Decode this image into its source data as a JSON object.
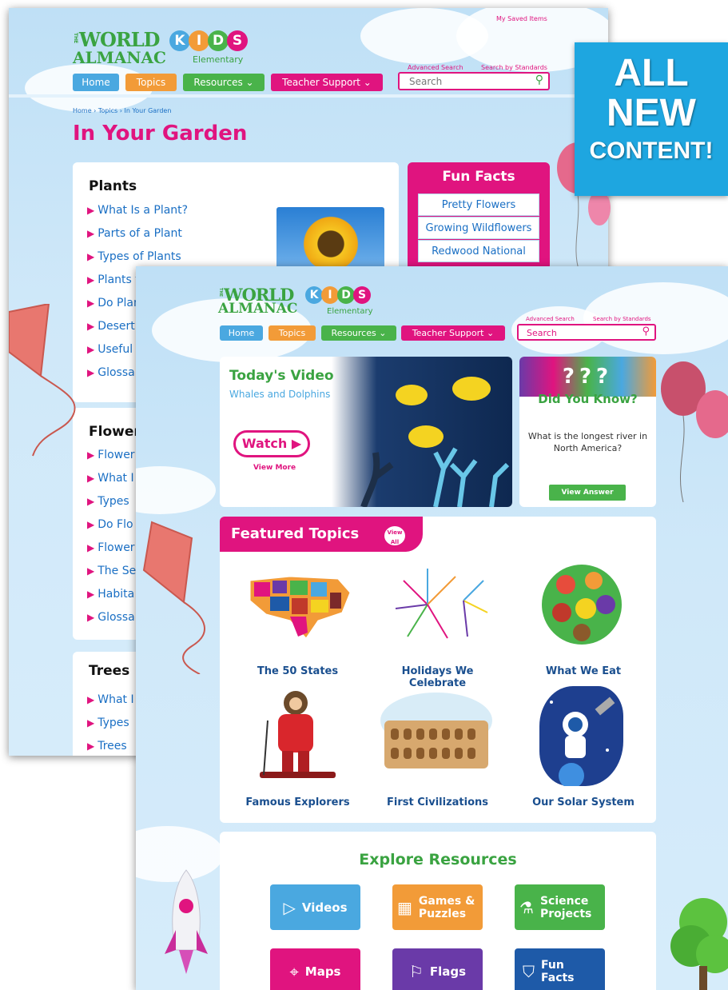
{
  "badge": {
    "line1": "ALL",
    "line2": "NEW",
    "line3": "CONTENT!"
  },
  "brand": {
    "the": "THE",
    "world": "WORLD",
    "almanac": "ALMANAC",
    "kids": [
      "K",
      "I",
      "D",
      "S"
    ],
    "elementary": "Elementary"
  },
  "header": {
    "saved_items": "My Saved Items",
    "advanced_search": "Advanced Search",
    "search_by_standards": "Search by Standards",
    "search_placeholder": "Search",
    "nav": {
      "home": "Home",
      "topics": "Topics",
      "resources": "Resources ⌄",
      "teacher": "Teacher Support ⌄"
    }
  },
  "back_page": {
    "breadcrumb": "Home › Topics › In Your Garden",
    "title": "In Your Garden",
    "plants": {
      "title": "Plants",
      "items": [
        "What Is a Plant?",
        "Parts of a Plant",
        "Types of Plants",
        "Plants t",
        "Do Plan",
        "Desert",
        "Useful",
        "Glossar"
      ]
    },
    "flowers": {
      "title": "Flowers",
      "items": [
        "Flower",
        "What I",
        "Types",
        "Do Flo",
        "Flower",
        "The Se",
        "Habita",
        "Glossar"
      ]
    },
    "trees": {
      "title": "Trees",
      "items": [
        "What I",
        "Types",
        "Trees"
      ]
    },
    "fun_facts": {
      "title": "Fun Facts",
      "items": [
        "Pretty Flowers",
        "Growing Wildflowers",
        "Redwood National Park"
      ]
    }
  },
  "front_page": {
    "video": {
      "title": "Today's Video",
      "subtitle": "Whales and Dolphins",
      "watch": "Watch ▶",
      "view_more": "View More"
    },
    "dyk": {
      "title": "Did You Know?",
      "question": "What is the longest river in North America?",
      "button": "View Answer"
    },
    "featured": {
      "title": "Featured Topics",
      "view_all": "View All",
      "topics": [
        "The 50 States",
        "Holidays We Celebrate",
        "What We Eat",
        "Famous Explorers",
        "First Civilizations",
        "Our Solar System"
      ]
    },
    "explore": {
      "title": "Explore Resources",
      "buttons": [
        {
          "label": "Videos",
          "color": "#4aa8e0",
          "icon": "play-icon"
        },
        {
          "label": "Games & Puzzles",
          "color": "#f29b38",
          "icon": "puzzle-grid-icon"
        },
        {
          "label": "Science Projects",
          "color": "#49b34a",
          "icon": "flask-icon"
        },
        {
          "label": "Maps",
          "color": "#e0147f",
          "icon": "map-pin-icon"
        },
        {
          "label": "Flags",
          "color": "#6a3aa8",
          "icon": "flag-icon"
        },
        {
          "label": "Fun Facts",
          "color": "#1e5aa8",
          "icon": "shield-check-icon"
        }
      ]
    }
  },
  "colors": {
    "pink": "#e0147f",
    "green": "#3aa341",
    "blue": "#4aa8e0",
    "orange": "#f29b38",
    "sky": "#cfe8f9"
  }
}
